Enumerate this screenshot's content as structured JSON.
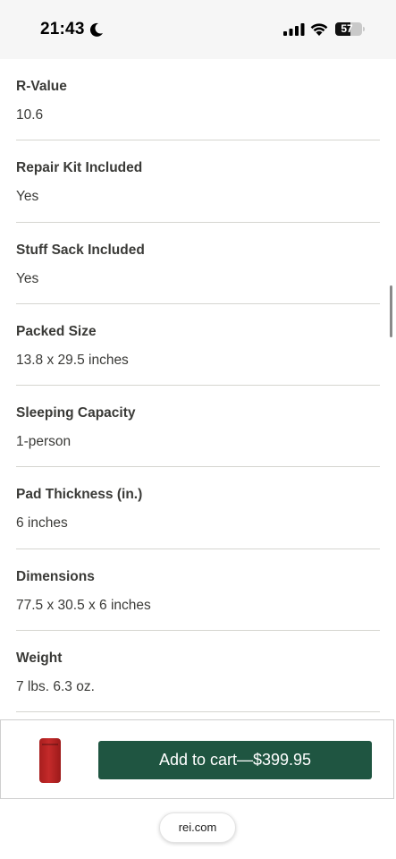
{
  "status_bar": {
    "time": "21:43",
    "battery_level": "57",
    "battery_fraction": 0.57,
    "icons": [
      "moon-icon",
      "signal-icon",
      "wifi-icon",
      "battery-icon"
    ]
  },
  "specs": [
    {
      "label": "R-Value",
      "value": "10.6"
    },
    {
      "label": "Repair Kit Included",
      "value": "Yes"
    },
    {
      "label": "Stuff Sack Included",
      "value": "Yes"
    },
    {
      "label": "Packed Size",
      "value": "13.8 x 29.5 inches"
    },
    {
      "label": "Sleeping Capacity",
      "value": "1-person"
    },
    {
      "label": "Pad Thickness (in.)",
      "value": "6 inches"
    },
    {
      "label": "Dimensions",
      "value": "77.5 x 30.5 x 6 inches"
    },
    {
      "label": "Weight",
      "value": "7 lbs. 6.3 oz."
    }
  ],
  "cart": {
    "button_label": "Add to cart—$399.95",
    "button_color": "#1f5541",
    "thumb_color": "#b32222"
  },
  "browser": {
    "url": "rei.com"
  }
}
